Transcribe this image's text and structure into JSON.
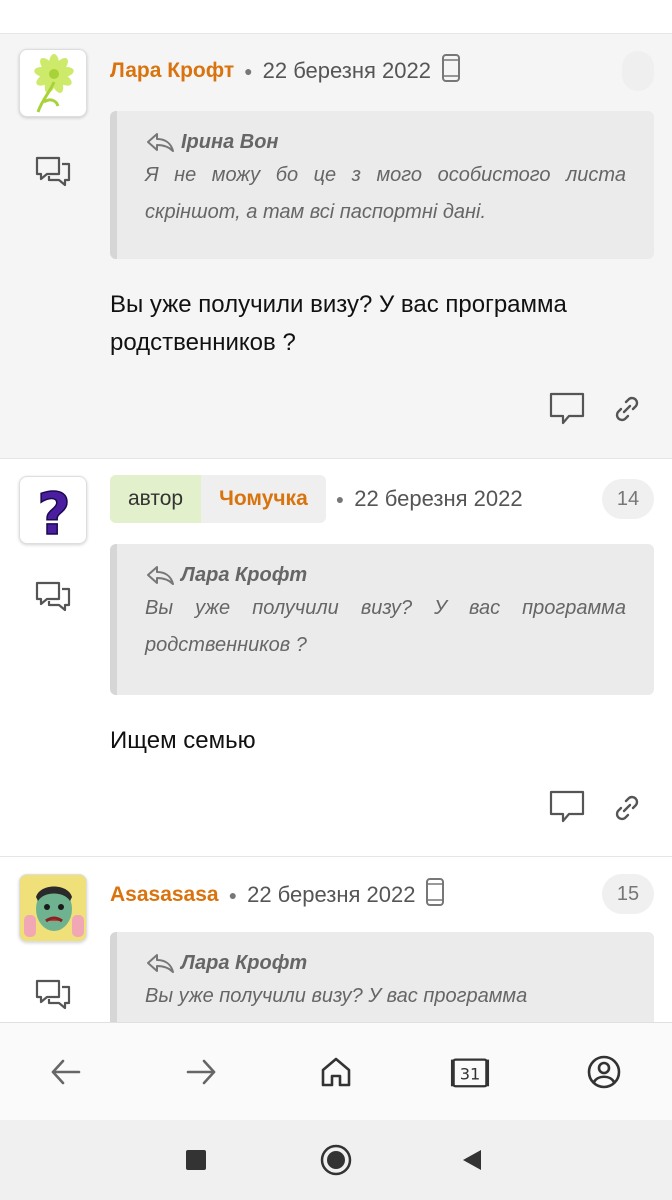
{
  "posts": [
    {
      "username": "Лара Крофт",
      "date": "22 березня 2022",
      "quote_author": "Ірина Вон",
      "quote_text": "Я не можу бо це з мого особистого листа скріншот, а там всі паспортні дані.",
      "body": "Вы уже получили визу? У вас программа родственников ?"
    },
    {
      "author_tag": "автор",
      "username": "Чомучка",
      "date": "22 березня 2022",
      "number": "14",
      "quote_author": "Лара Крофт",
      "quote_text": "Вы уже получили визу? У вас программа родственников ?",
      "body": "Ищем семью"
    },
    {
      "username": "Asasasasa",
      "date": "22 березня 2022",
      "number": "15",
      "quote_author": "Лара Крофт",
      "quote_text": "Вы уже получили визу? У вас программа"
    }
  ],
  "bottom_nav": {
    "calendar_day": "31",
    "icons": [
      "back-arrow-icon",
      "forward-arrow-icon",
      "home-icon",
      "calendar-icon",
      "account-icon"
    ]
  },
  "colors": {
    "username": "#d9730d",
    "author_tag_bg": "#e2f0cc"
  }
}
